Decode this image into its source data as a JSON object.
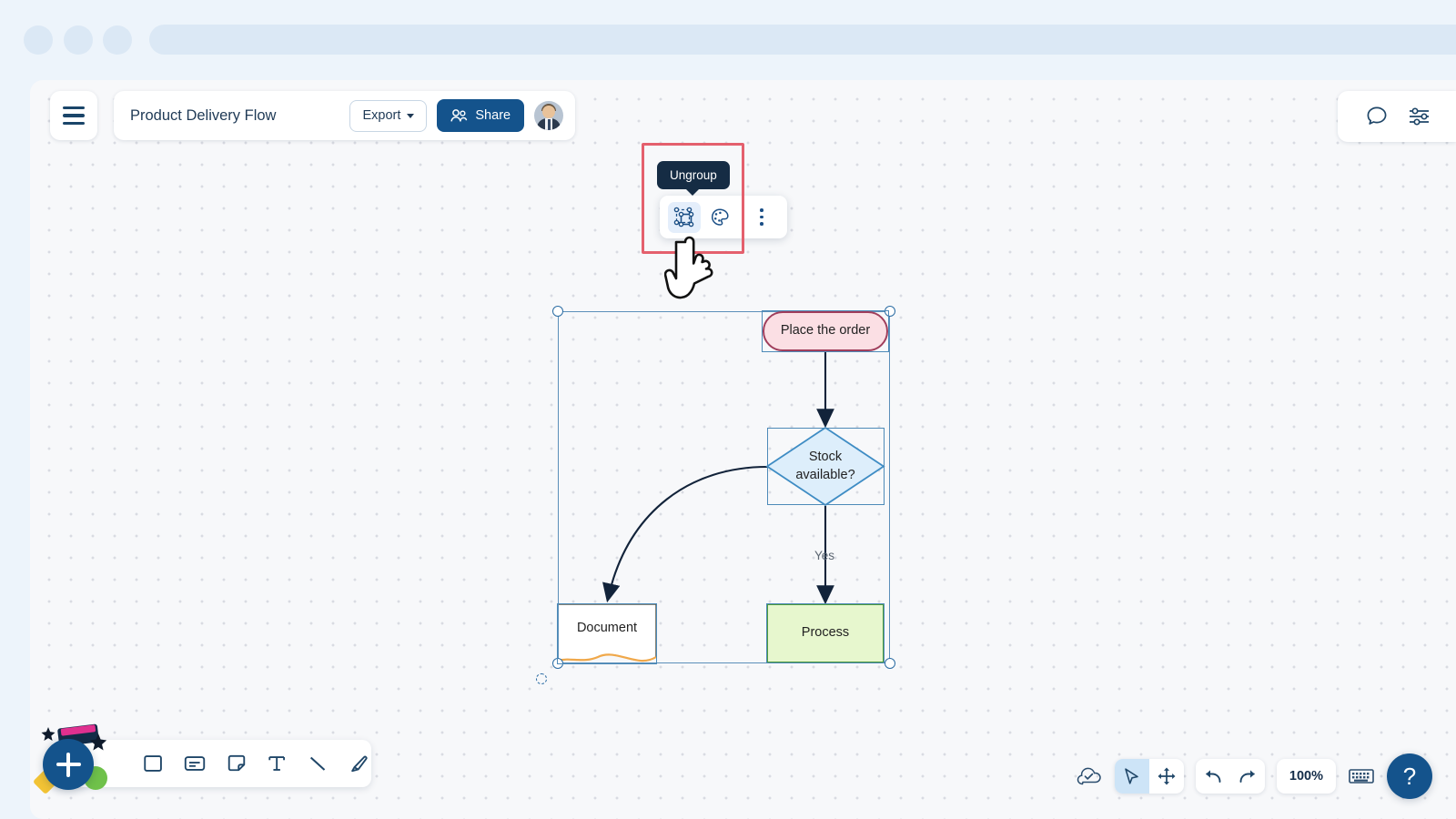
{
  "browser_chrome": {
    "dots": [
      "dot-1",
      "dot-2",
      "dot-3"
    ],
    "url_placeholder": ""
  },
  "header": {
    "menu_icon": "hamburger-icon",
    "document_title": "Product Delivery Flow",
    "export_label": "Export",
    "export_caret": "chevron-down-icon",
    "share_label": "Share",
    "share_icon": "people-icon",
    "avatar": "user-avatar"
  },
  "top_right": {
    "comment_icon": "comment-bubble-icon",
    "settings_icon": "sliders-icon"
  },
  "shape_toolbar": {
    "tooltip": "Ungroup",
    "ungroup_icon": "ungroup-icon",
    "palette_icon": "color-palette-icon",
    "more_icon": "more-vertical-icon",
    "annotation_color": "#e4606d"
  },
  "cursor": {
    "type": "pointing-hand-cursor"
  },
  "diagram": {
    "nodes": [
      {
        "id": "place-order",
        "label": "Place the order",
        "shape": "rounded-rectangle",
        "fill": "#fbdfe4",
        "stroke": "#a03e5c"
      },
      {
        "id": "stock-available",
        "label": "Stock\navailable?",
        "label_line1": "Stock",
        "label_line2": "available?",
        "shape": "diamond",
        "fill": "#ddeefb",
        "stroke": "#3e8cc4"
      },
      {
        "id": "process",
        "label": "Process",
        "shape": "rectangle",
        "fill": "#e7f7ce",
        "stroke": "#4e9a3c"
      },
      {
        "id": "document",
        "label": "Document",
        "shape": "document",
        "fill": "#ffffff",
        "stroke": "#5f5c4a",
        "accent": "#eda martinez"
      }
    ],
    "edges": [
      {
        "from": "place-order",
        "to": "stock-available",
        "label": ""
      },
      {
        "from": "stock-available",
        "to": "process",
        "label": "Yes"
      },
      {
        "from": "stock-available",
        "to": "document",
        "label": ""
      }
    ],
    "selection": {
      "type": "group-selection",
      "handle_count": 4,
      "rotate_handle": true
    }
  },
  "bottom_toolbar": {
    "add_label": "+",
    "tools": [
      {
        "name": "shape-tool",
        "icon": "square-icon"
      },
      {
        "name": "card-tool",
        "icon": "card-icon"
      },
      {
        "name": "note-tool",
        "icon": "sticky-note-icon"
      },
      {
        "name": "text-tool",
        "icon": "text-icon"
      },
      {
        "name": "line-tool",
        "icon": "line-icon"
      },
      {
        "name": "pen-tool",
        "icon": "marker-pen-icon"
      }
    ]
  },
  "bottom_right": {
    "cloud_icon": "cloud-saved-icon",
    "select_icon": "cursor-arrow-icon",
    "pan_icon": "move-arrows-icon",
    "undo_icon": "undo-icon",
    "redo_icon": "redo-icon",
    "zoom_level": "100%",
    "keyboard_icon": "keyboard-icon",
    "help_label": "?"
  }
}
